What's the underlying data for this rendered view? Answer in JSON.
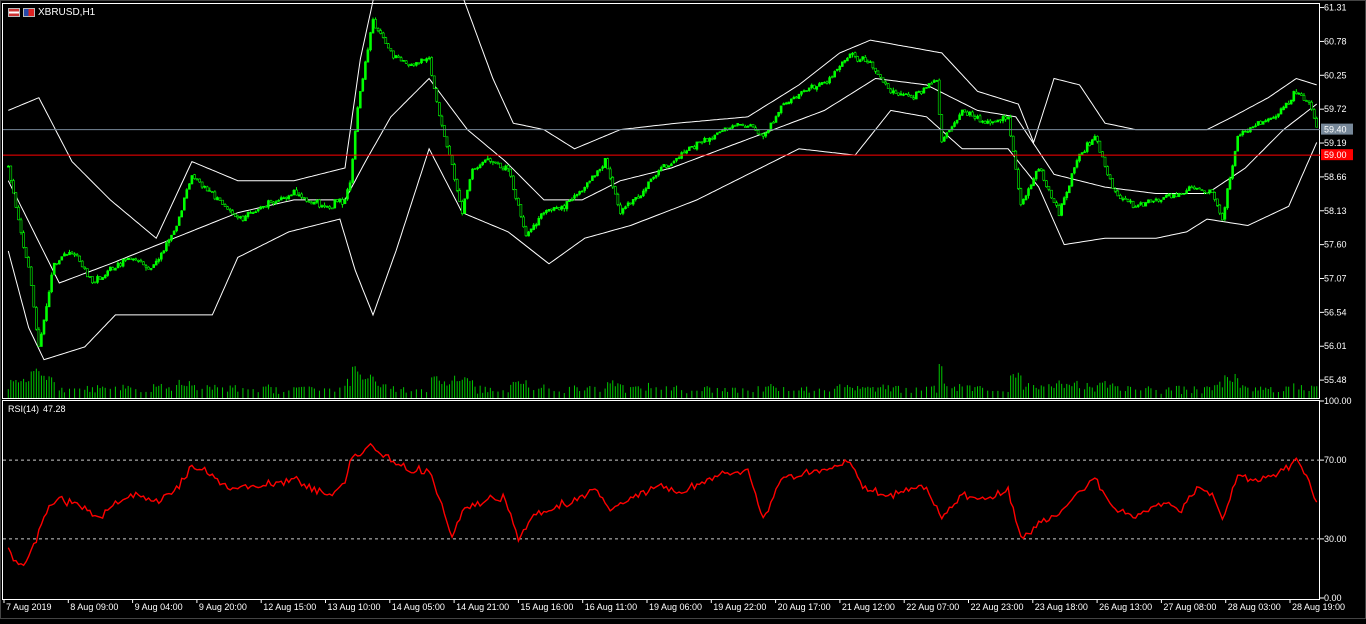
{
  "header": {
    "symbol": "XBRUSD,H1"
  },
  "rsi": {
    "label": "RSI(14)",
    "value": "47.28"
  },
  "price_labels": {
    "bid": "59.40",
    "ask": "59.00",
    "extra": "59.19"
  },
  "colors": {
    "background": "#000000",
    "bull_candle": "#00ff00",
    "bear_candle": "#000000",
    "wick": "#00ff00",
    "bands": "#ffffff",
    "volume": "#00c800",
    "rsi": "#ff0000",
    "ask_line": "#ff0000",
    "bid_line": "#778899",
    "grid": "#cccccc",
    "bid_label_bg": "#778899",
    "ask_label_bg": "#ff0000"
  },
  "chart_data": [
    {
      "type": "candlestick",
      "title": "XBRUSD,H1",
      "y_ticks": [
        "61.31",
        "60.78",
        "60.25",
        "59.72",
        "59.19",
        "58.66",
        "58.13",
        "57.60",
        "57.07",
        "56.54",
        "56.01",
        "55.48"
      ],
      "ylim": [
        55.2,
        61.35
      ],
      "x_ticks": [
        "7 Aug 2019",
        "8 Aug 09:00",
        "9 Aug 04:00",
        "9 Aug 20:00",
        "12 Aug 15:00",
        "13 Aug 10:00",
        "14 Aug 05:00",
        "14 Aug 21:00",
        "15 Aug 16:00",
        "16 Aug 11:00",
        "19 Aug 06:00",
        "19 Aug 22:00",
        "20 Aug 17:00",
        "21 Aug 12:00",
        "22 Aug 07:00",
        "22 Aug 23:00",
        "23 Aug 18:00",
        "26 Aug 13:00",
        "27 Aug 08:00",
        "28 Aug 03:00",
        "28 Aug 19:00"
      ],
      "key_path": [
        [
          0,
          58.8
        ],
        [
          8,
          57.2
        ],
        [
          12,
          56.0
        ],
        [
          18,
          57.3
        ],
        [
          25,
          57.5
        ],
        [
          33,
          57.0
        ],
        [
          40,
          57.2
        ],
        [
          48,
          57.4
        ],
        [
          56,
          57.2
        ],
        [
          65,
          57.8
        ],
        [
          72,
          58.7
        ],
        [
          80,
          58.4
        ],
        [
          90,
          58.0
        ],
        [
          100,
          58.2
        ],
        [
          112,
          58.4
        ],
        [
          124,
          58.2
        ],
        [
          132,
          58.3
        ],
        [
          134,
          58.6
        ],
        [
          137,
          59.8
        ],
        [
          143,
          61.1
        ],
        [
          150,
          60.6
        ],
        [
          158,
          60.4
        ],
        [
          165,
          60.5
        ],
        [
          169,
          59.6
        ],
        [
          173,
          59.0
        ],
        [
          178,
          58.1
        ],
        [
          182,
          58.8
        ],
        [
          188,
          58.9
        ],
        [
          196,
          58.8
        ],
        [
          203,
          57.7
        ],
        [
          210,
          58.1
        ],
        [
          218,
          58.2
        ],
        [
          226,
          58.5
        ],
        [
          234,
          58.9
        ],
        [
          240,
          58.1
        ],
        [
          248,
          58.4
        ],
        [
          256,
          58.8
        ],
        [
          264,
          59.0
        ],
        [
          272,
          59.2
        ],
        [
          280,
          59.4
        ],
        [
          288,
          59.5
        ],
        [
          296,
          59.3
        ],
        [
          304,
          59.8
        ],
        [
          312,
          60.0
        ],
        [
          322,
          60.2
        ],
        [
          330,
          60.6
        ],
        [
          338,
          60.4
        ],
        [
          346,
          60.0
        ],
        [
          354,
          59.9
        ],
        [
          364,
          60.2
        ],
        [
          366,
          59.2
        ],
        [
          374,
          59.7
        ],
        [
          382,
          59.5
        ],
        [
          392,
          59.6
        ],
        [
          397,
          58.2
        ],
        [
          404,
          58.8
        ],
        [
          412,
          58.1
        ],
        [
          420,
          59.0
        ],
        [
          426,
          59.3
        ],
        [
          434,
          58.4
        ],
        [
          442,
          58.2
        ],
        [
          452,
          58.3
        ],
        [
          460,
          58.4
        ],
        [
          466,
          58.5
        ],
        [
          472,
          58.4
        ],
        [
          476,
          58.0
        ],
        [
          482,
          59.3
        ],
        [
          490,
          59.5
        ],
        [
          497,
          59.6
        ],
        [
          505,
          60.0
        ],
        [
          510,
          59.8
        ],
        [
          513,
          59.5
        ]
      ],
      "bb_mid_path": [
        [
          0,
          58.6
        ],
        [
          20,
          57.0
        ],
        [
          40,
          57.3
        ],
        [
          65,
          57.7
        ],
        [
          90,
          58.1
        ],
        [
          112,
          58.3
        ],
        [
          132,
          58.3
        ],
        [
          140,
          58.9
        ],
        [
          150,
          59.6
        ],
        [
          165,
          60.2
        ],
        [
          180,
          59.4
        ],
        [
          195,
          58.9
        ],
        [
          210,
          58.3
        ],
        [
          225,
          58.3
        ],
        [
          240,
          58.6
        ],
        [
          260,
          58.8
        ],
        [
          280,
          59.1
        ],
        [
          300,
          59.4
        ],
        [
          320,
          59.7
        ],
        [
          340,
          60.2
        ],
        [
          360,
          60.1
        ],
        [
          380,
          59.7
        ],
        [
          395,
          59.6
        ],
        [
          410,
          58.7
        ],
        [
          430,
          58.5
        ],
        [
          450,
          58.4
        ],
        [
          470,
          58.4
        ],
        [
          485,
          58.8
        ],
        [
          500,
          59.4
        ],
        [
          513,
          59.8
        ]
      ],
      "bb_upper_path": [
        [
          0,
          59.7
        ],
        [
          12,
          59.9
        ],
        [
          25,
          58.9
        ],
        [
          40,
          58.3
        ],
        [
          58,
          57.7
        ],
        [
          72,
          58.9
        ],
        [
          90,
          58.6
        ],
        [
          112,
          58.6
        ],
        [
          132,
          58.8
        ],
        [
          138,
          60.5
        ],
        [
          144,
          61.6
        ],
        [
          165,
          61.8
        ],
        [
          178,
          61.5
        ],
        [
          190,
          60.2
        ],
        [
          198,
          59.5
        ],
        [
          210,
          59.4
        ],
        [
          222,
          59.1
        ],
        [
          240,
          59.4
        ],
        [
          262,
          59.5
        ],
        [
          290,
          59.6
        ],
        [
          310,
          60.1
        ],
        [
          326,
          60.6
        ],
        [
          338,
          60.8
        ],
        [
          352,
          60.7
        ],
        [
          366,
          60.6
        ],
        [
          380,
          60.0
        ],
        [
          396,
          59.8
        ],
        [
          402,
          59.2
        ],
        [
          410,
          60.2
        ],
        [
          420,
          60.1
        ],
        [
          430,
          59.5
        ],
        [
          442,
          59.4
        ],
        [
          460,
          59.4
        ],
        [
          470,
          59.4
        ],
        [
          480,
          59.6
        ],
        [
          494,
          59.9
        ],
        [
          505,
          60.2
        ],
        [
          513,
          60.1
        ]
      ],
      "bb_lower_path": [
        [
          0,
          57.5
        ],
        [
          8,
          56.3
        ],
        [
          14,
          55.8
        ],
        [
          30,
          56.0
        ],
        [
          42,
          56.5
        ],
        [
          60,
          56.5
        ],
        [
          80,
          56.5
        ],
        [
          90,
          57.4
        ],
        [
          110,
          57.8
        ],
        [
          130,
          58.0
        ],
        [
          136,
          57.2
        ],
        [
          143,
          56.5
        ],
        [
          152,
          57.5
        ],
        [
          165,
          59.1
        ],
        [
          178,
          58.1
        ],
        [
          196,
          57.8
        ],
        [
          212,
          57.3
        ],
        [
          226,
          57.7
        ],
        [
          244,
          57.9
        ],
        [
          270,
          58.3
        ],
        [
          290,
          58.7
        ],
        [
          310,
          59.1
        ],
        [
          332,
          59.0
        ],
        [
          346,
          59.7
        ],
        [
          360,
          59.6
        ],
        [
          374,
          59.1
        ],
        [
          392,
          59.1
        ],
        [
          404,
          58.5
        ],
        [
          414,
          57.6
        ],
        [
          430,
          57.7
        ],
        [
          450,
          57.7
        ],
        [
          462,
          57.8
        ],
        [
          470,
          58.0
        ],
        [
          486,
          57.9
        ],
        [
          502,
          58.2
        ],
        [
          513,
          59.2
        ]
      ],
      "current_bid": 59.4,
      "current_ask": 59.0,
      "n_bars": 514
    },
    {
      "type": "line",
      "title": "RSI(14) 47.28",
      "series": [
        {
          "name": "RSI(14)",
          "last": 47.28
        }
      ],
      "y_ticks": [
        "100.00",
        "70.00",
        "30.00",
        "0.00"
      ],
      "ylim": [
        0,
        100
      ],
      "levels": [
        70,
        30
      ],
      "key_path": [
        [
          0,
          25
        ],
        [
          6,
          15
        ],
        [
          11,
          30
        ],
        [
          14,
          43
        ],
        [
          20,
          50
        ],
        [
          27,
          48
        ],
        [
          35,
          40
        ],
        [
          42,
          48
        ],
        [
          50,
          53
        ],
        [
          58,
          48
        ],
        [
          66,
          55
        ],
        [
          72,
          68
        ],
        [
          80,
          62
        ],
        [
          88,
          55
        ],
        [
          100,
          57
        ],
        [
          112,
          60
        ],
        [
          124,
          52
        ],
        [
          132,
          58
        ],
        [
          134,
          70
        ],
        [
          142,
          78
        ],
        [
          150,
          70
        ],
        [
          158,
          65
        ],
        [
          165,
          65
        ],
        [
          169,
          50
        ],
        [
          174,
          30
        ],
        [
          178,
          45
        ],
        [
          188,
          50
        ],
        [
          195,
          50
        ],
        [
          200,
          30
        ],
        [
          206,
          42
        ],
        [
          214,
          45
        ],
        [
          222,
          50
        ],
        [
          230,
          55
        ],
        [
          236,
          45
        ],
        [
          244,
          50
        ],
        [
          256,
          58
        ],
        [
          262,
          53
        ],
        [
          270,
          57
        ],
        [
          280,
          63
        ],
        [
          290,
          65
        ],
        [
          296,
          40
        ],
        [
          304,
          62
        ],
        [
          312,
          63
        ],
        [
          320,
          65
        ],
        [
          330,
          70
        ],
        [
          336,
          55
        ],
        [
          346,
          52
        ],
        [
          360,
          57
        ],
        [
          366,
          40
        ],
        [
          374,
          53
        ],
        [
          382,
          50
        ],
        [
          392,
          55
        ],
        [
          397,
          30
        ],
        [
          404,
          38
        ],
        [
          412,
          42
        ],
        [
          420,
          55
        ],
        [
          426,
          60
        ],
        [
          434,
          45
        ],
        [
          442,
          42
        ],
        [
          452,
          48
        ],
        [
          460,
          45
        ],
        [
          466,
          55
        ],
        [
          472,
          53
        ],
        [
          476,
          40
        ],
        [
          482,
          62
        ],
        [
          490,
          60
        ],
        [
          497,
          63
        ],
        [
          505,
          70
        ],
        [
          510,
          60
        ],
        [
          513,
          48
        ]
      ]
    }
  ]
}
